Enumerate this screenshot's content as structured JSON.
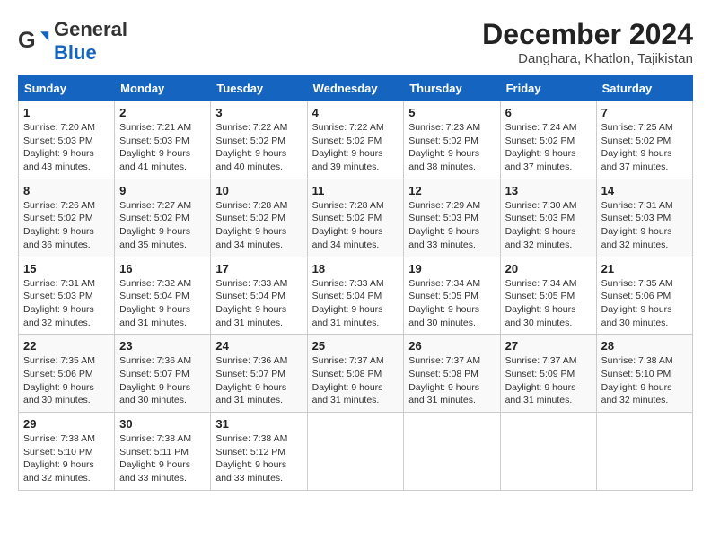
{
  "logo": {
    "general": "General",
    "blue": "Blue"
  },
  "title": {
    "month": "December 2024",
    "location": "Danghara, Khatlon, Tajikistan"
  },
  "headers": [
    "Sunday",
    "Monday",
    "Tuesday",
    "Wednesday",
    "Thursday",
    "Friday",
    "Saturday"
  ],
  "weeks": [
    [
      {
        "day": "1",
        "sunrise": "7:20 AM",
        "sunset": "5:03 PM",
        "daylight": "9 hours and 43 minutes."
      },
      {
        "day": "2",
        "sunrise": "7:21 AM",
        "sunset": "5:03 PM",
        "daylight": "9 hours and 41 minutes."
      },
      {
        "day": "3",
        "sunrise": "7:22 AM",
        "sunset": "5:02 PM",
        "daylight": "9 hours and 40 minutes."
      },
      {
        "day": "4",
        "sunrise": "7:22 AM",
        "sunset": "5:02 PM",
        "daylight": "9 hours and 39 minutes."
      },
      {
        "day": "5",
        "sunrise": "7:23 AM",
        "sunset": "5:02 PM",
        "daylight": "9 hours and 38 minutes."
      },
      {
        "day": "6",
        "sunrise": "7:24 AM",
        "sunset": "5:02 PM",
        "daylight": "9 hours and 37 minutes."
      },
      {
        "day": "7",
        "sunrise": "7:25 AM",
        "sunset": "5:02 PM",
        "daylight": "9 hours and 37 minutes."
      }
    ],
    [
      {
        "day": "8",
        "sunrise": "7:26 AM",
        "sunset": "5:02 PM",
        "daylight": "9 hours and 36 minutes."
      },
      {
        "day": "9",
        "sunrise": "7:27 AM",
        "sunset": "5:02 PM",
        "daylight": "9 hours and 35 minutes."
      },
      {
        "day": "10",
        "sunrise": "7:28 AM",
        "sunset": "5:02 PM",
        "daylight": "9 hours and 34 minutes."
      },
      {
        "day": "11",
        "sunrise": "7:28 AM",
        "sunset": "5:02 PM",
        "daylight": "9 hours and 34 minutes."
      },
      {
        "day": "12",
        "sunrise": "7:29 AM",
        "sunset": "5:03 PM",
        "daylight": "9 hours and 33 minutes."
      },
      {
        "day": "13",
        "sunrise": "7:30 AM",
        "sunset": "5:03 PM",
        "daylight": "9 hours and 32 minutes."
      },
      {
        "day": "14",
        "sunrise": "7:31 AM",
        "sunset": "5:03 PM",
        "daylight": "9 hours and 32 minutes."
      }
    ],
    [
      {
        "day": "15",
        "sunrise": "7:31 AM",
        "sunset": "5:03 PM",
        "daylight": "9 hours and 32 minutes."
      },
      {
        "day": "16",
        "sunrise": "7:32 AM",
        "sunset": "5:04 PM",
        "daylight": "9 hours and 31 minutes."
      },
      {
        "day": "17",
        "sunrise": "7:33 AM",
        "sunset": "5:04 PM",
        "daylight": "9 hours and 31 minutes."
      },
      {
        "day": "18",
        "sunrise": "7:33 AM",
        "sunset": "5:04 PM",
        "daylight": "9 hours and 31 minutes."
      },
      {
        "day": "19",
        "sunrise": "7:34 AM",
        "sunset": "5:05 PM",
        "daylight": "9 hours and 30 minutes."
      },
      {
        "day": "20",
        "sunrise": "7:34 AM",
        "sunset": "5:05 PM",
        "daylight": "9 hours and 30 minutes."
      },
      {
        "day": "21",
        "sunrise": "7:35 AM",
        "sunset": "5:06 PM",
        "daylight": "9 hours and 30 minutes."
      }
    ],
    [
      {
        "day": "22",
        "sunrise": "7:35 AM",
        "sunset": "5:06 PM",
        "daylight": "9 hours and 30 minutes."
      },
      {
        "day": "23",
        "sunrise": "7:36 AM",
        "sunset": "5:07 PM",
        "daylight": "9 hours and 30 minutes."
      },
      {
        "day": "24",
        "sunrise": "7:36 AM",
        "sunset": "5:07 PM",
        "daylight": "9 hours and 31 minutes."
      },
      {
        "day": "25",
        "sunrise": "7:37 AM",
        "sunset": "5:08 PM",
        "daylight": "9 hours and 31 minutes."
      },
      {
        "day": "26",
        "sunrise": "7:37 AM",
        "sunset": "5:08 PM",
        "daylight": "9 hours and 31 minutes."
      },
      {
        "day": "27",
        "sunrise": "7:37 AM",
        "sunset": "5:09 PM",
        "daylight": "9 hours and 31 minutes."
      },
      {
        "day": "28",
        "sunrise": "7:38 AM",
        "sunset": "5:10 PM",
        "daylight": "9 hours and 32 minutes."
      }
    ],
    [
      {
        "day": "29",
        "sunrise": "7:38 AM",
        "sunset": "5:10 PM",
        "daylight": "9 hours and 32 minutes."
      },
      {
        "day": "30",
        "sunrise": "7:38 AM",
        "sunset": "5:11 PM",
        "daylight": "9 hours and 33 minutes."
      },
      {
        "day": "31",
        "sunrise": "7:38 AM",
        "sunset": "5:12 PM",
        "daylight": "9 hours and 33 minutes."
      },
      null,
      null,
      null,
      null
    ]
  ]
}
